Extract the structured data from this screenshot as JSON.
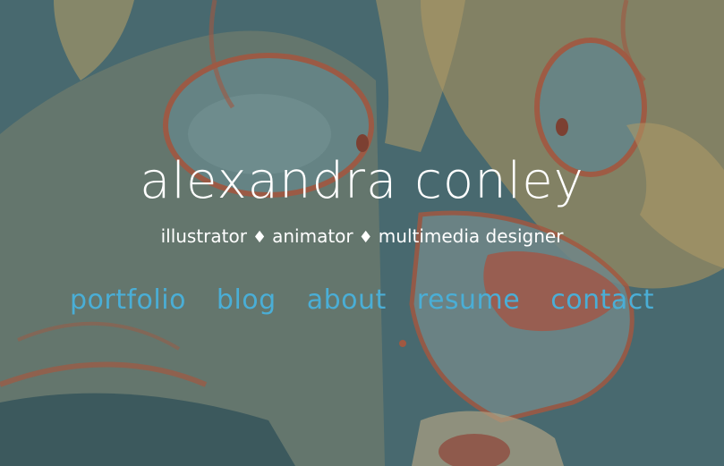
{
  "header": {
    "title": "alexandra conley",
    "tagline": {
      "roles": [
        "illustrator",
        "animator",
        "multimedia designer"
      ],
      "separator": "♦"
    }
  },
  "nav": {
    "items": [
      {
        "label": "portfolio"
      },
      {
        "label": "blog"
      },
      {
        "label": "about"
      },
      {
        "label": "resume"
      },
      {
        "label": "contact"
      }
    ],
    "link_color": "#4aaed6"
  },
  "colors": {
    "background_teal": "#4c6e74",
    "fur_orange": "#c9a868",
    "outline_red": "#b8573a",
    "title_white": "#ffffff"
  }
}
